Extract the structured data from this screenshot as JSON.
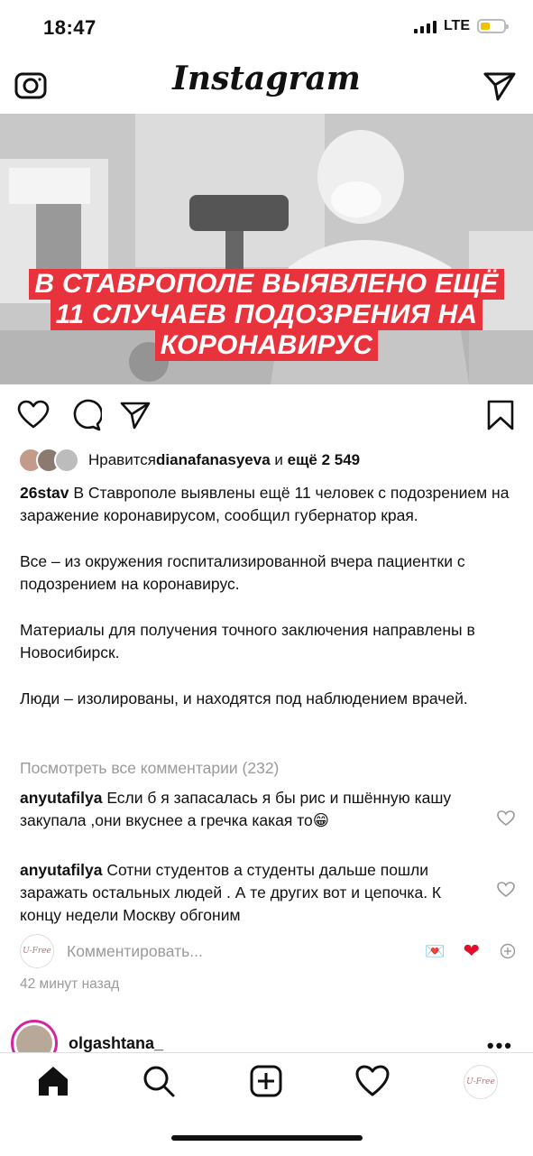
{
  "status_bar": {
    "time": "18:47",
    "network": "LTE"
  },
  "header": {
    "brand": "Instagram",
    "left_icon": "camera-icon",
    "right_icon": "send-icon"
  },
  "post": {
    "headline_lines": [
      "В СТАВРОПОЛЕ ВЫЯВЛЕНО ЕЩЁ",
      "11 СЛУЧАЕВ ПОДОЗРЕНИЯ НА",
      "КОРОНАВИРУС"
    ],
    "headline_color": "#e8323c",
    "likes": {
      "prefix": "Нравится ",
      "user": "dianafanasyeva",
      "middle": " и ",
      "count": "ещё 2 549"
    },
    "caption": {
      "author": "26stav",
      "paragraphs": [
        "В Ставрополе выявлены ещё 11 человек с подозрением на заражение коронавирусом, сообщил губернатор края.",
        "Все – из окружения госпитализированной вчера пациентки с подозрением на коронавирус.",
        "Материалы для получения точного заключения направлены в Новосибирск.",
        "Люди – изолированы, и находятся под наблюдением врачей."
      ]
    },
    "view_all_comments": "Посмотреть все комментарии (232)",
    "comments": [
      {
        "user": "anyutafilya",
        "text": "Если б я запасалась я бы рис и пшённую кашу закупала ,они вкуснее а гречка какая то",
        "emoji": "😁"
      },
      {
        "user": "anyutafilya",
        "text": "Сотни студентов а студенты дальше пошли заражать остальных людей . А те других вот и цепочка. К концу недели Москву обгоним",
        "emoji": ""
      }
    ],
    "add_comment_placeholder": "Комментировать...",
    "self_avatar_text": "U-Free",
    "quick_emoji_1": "💌",
    "quick_emoji_2": "❤",
    "time_ago": "42 минут назад"
  },
  "next_post": {
    "user": "olgashtana_"
  },
  "tabbar": {
    "items": [
      "home-icon",
      "search-icon",
      "add-post-icon",
      "activity-heart-icon",
      "profile-avatar"
    ],
    "profile_text": "U-Free"
  }
}
